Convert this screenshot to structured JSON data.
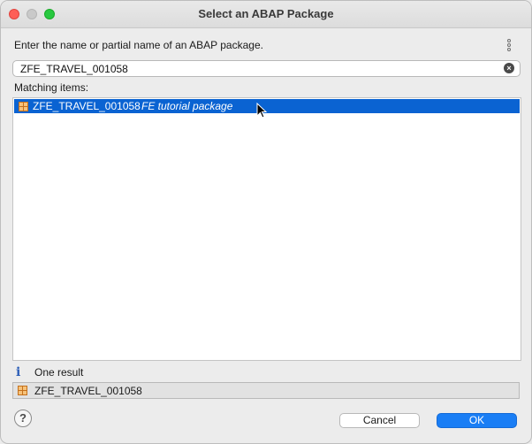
{
  "window": {
    "title": "Select an ABAP Package"
  },
  "prompt": "Enter the name or partial name of an ABAP package.",
  "search": {
    "value": "ZFE_TRAVEL_001058"
  },
  "list": {
    "label": "Matching items:",
    "items": [
      {
        "name": "ZFE_TRAVEL_001058",
        "description": "FE tutorial package",
        "selected": true
      }
    ]
  },
  "status": {
    "text": "One result",
    "selected_name": "ZFE_TRAVEL_001058"
  },
  "buttons": {
    "cancel": "Cancel",
    "ok": "OK",
    "help": "?"
  },
  "icons": {
    "package": "package-icon",
    "info": "info-icon",
    "menu": "view-menu-icon",
    "clear": "clear-search-icon"
  },
  "colors": {
    "selection": "#0a63d2",
    "ok_button": "#1a7ef5",
    "package_icon": "#d88a2a"
  }
}
